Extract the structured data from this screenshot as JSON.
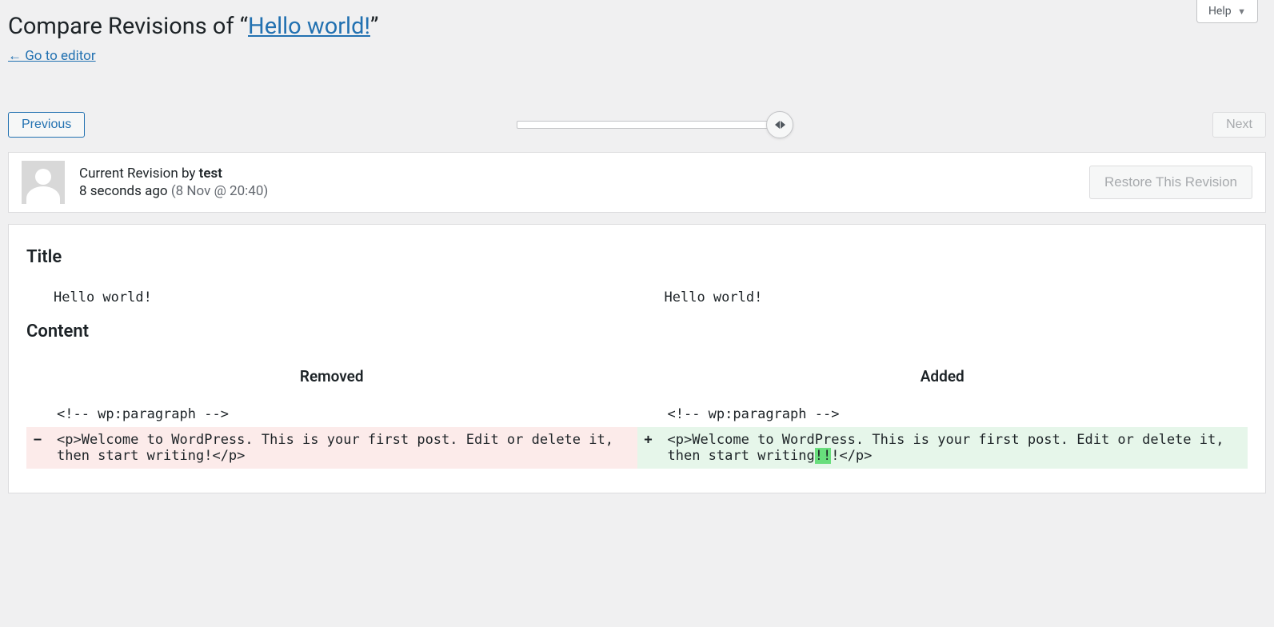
{
  "help": {
    "label": "Help"
  },
  "heading": {
    "prefix": "Compare Revisions of “",
    "post_title": "Hello world!",
    "suffix": "”"
  },
  "go_editor": "← Go to editor",
  "nav": {
    "previous": "Previous",
    "next": "Next"
  },
  "revision": {
    "label_prefix": "Current Revision by ",
    "author": "test",
    "time_ago": "8 seconds ago",
    "timestamp": "(8 Nov @ 20:40)",
    "restore_label": "Restore This Revision"
  },
  "diff": {
    "title_heading": "Title",
    "content_heading": "Content",
    "removed_label": "Removed",
    "added_label": "Added",
    "title_left": "Hello world!",
    "title_right": "Hello world!",
    "ctx_left": "<!-- wp:paragraph -->",
    "ctx_right": "<!-- wp:paragraph -->",
    "removed_line": "<p>Welcome to WordPress. This is your first post. Edit or delete it, then start writing!</p>",
    "added_pre": "<p>Welcome to WordPress. This is your first post. Edit or delete it, then start writing",
    "added_hl": "!!",
    "added_post": "!</p>",
    "minus": "−",
    "plus": "+"
  }
}
